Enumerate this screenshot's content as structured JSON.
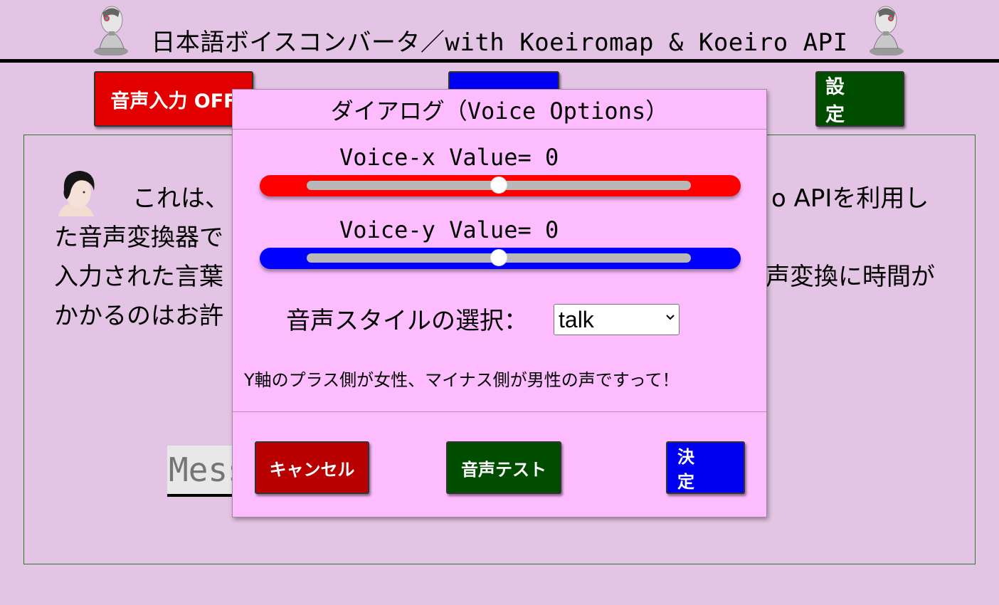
{
  "header": {
    "title": "日本語ボイスコンバータ／with Koeiromap & Koeiro API",
    "robot_icon": "robot-head-icon"
  },
  "toolbar": {
    "voice_input_label": "音声入力 OFF",
    "settings_label": "設 定"
  },
  "main": {
    "intro_lines": [
      "これは、",
      "o APIを利用し",
      "た音声変換器で",
      "入力された言葉",
      "声変換に時間が",
      "かかるのはお許"
    ],
    "message_placeholder": "Mess"
  },
  "dialog": {
    "title": "ダイアログ（Voice Options）",
    "voice_x": {
      "label": "Voice-x Value= 0",
      "value": 0,
      "min": -10,
      "max": 10,
      "color": "#ff0000"
    },
    "voice_y": {
      "label": "Voice-y Value= 0",
      "value": 0,
      "min": -10,
      "max": 10,
      "color": "#0000ff"
    },
    "style_label": "音声スタイルの選択：",
    "style_selected": "talk",
    "note": "Y軸のプラス側が女性、マイナス側が男性の声ですって！",
    "cancel_label": "キャンセル",
    "test_label": "音声テスト",
    "ok_label": "決 定"
  },
  "colors": {
    "page_bg": "#e4c4e4",
    "dialog_bg": "#fdbcfd",
    "red_button": "#e20000",
    "blue_button": "#0000f2",
    "green_button": "#004d00"
  }
}
